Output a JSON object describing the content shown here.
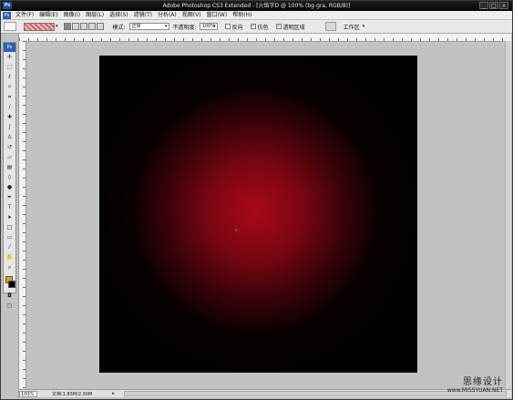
{
  "app": {
    "badge": "Ps",
    "title": "Adobe Photoshop CS3 Extended - [火焰字D @ 100% (bg-gra, RGB/8)]",
    "win_buttons": [
      "_",
      "□",
      "×"
    ]
  },
  "menu": {
    "logo": "Ps",
    "items": [
      "文件(F)",
      "编辑(E)",
      "图像(I)",
      "图层(L)",
      "选择(S)",
      "滤镜(T)",
      "分析(A)",
      "视图(V)",
      "窗口(W)",
      "帮助(H)"
    ]
  },
  "options": {
    "mode_label": "模式:",
    "mode_value": "正常",
    "opacity_label": "不透明度:",
    "opacity_value": "100%",
    "reverse_label": "反向",
    "dither_label": "仿色",
    "transparency_label": "透明区域",
    "reverse_checked": false,
    "dither_checked": true,
    "transparency_checked": true,
    "workspace_label": "工作区"
  },
  "toolbox": {
    "header": "Ps",
    "tools": [
      "move-tool",
      "marquee-tool",
      "lasso-tool",
      "magic-wand-tool",
      "crop-tool",
      "slice-tool",
      "healing-brush-tool",
      "brush-tool",
      "clone-stamp-tool",
      "history-brush-tool",
      "eraser-tool",
      "gradient-tool",
      "blur-tool",
      "dodge-tool",
      "pen-tool",
      "type-tool",
      "path-selection-tool",
      "shape-tool",
      "notes-tool",
      "eyedropper-tool",
      "hand-tool",
      "zoom-tool"
    ],
    "foreground_color": "#e5a500",
    "background_color": "#000000"
  },
  "status": {
    "zoom": "100%",
    "doc_size": "文档:1.83M/2.30M",
    "arrow": "▸"
  },
  "canvas": {
    "gradient_center_color": "#a80817",
    "edge_color": "#000000"
  },
  "watermark": {
    "line1": "思缘设计",
    "line2": "www.MISSYUAN.NET"
  }
}
